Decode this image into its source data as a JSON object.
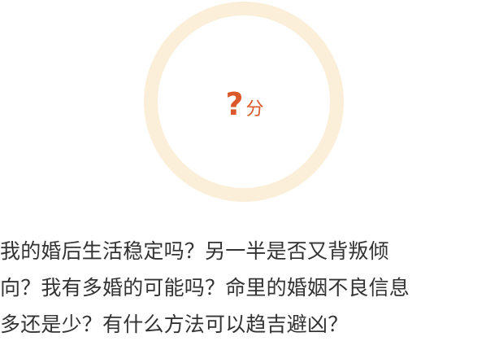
{
  "score": {
    "value": "?",
    "unit": "分"
  },
  "question": {
    "lines": [
      "我的婚后生活稳定吗？另一半是否又背叛倾",
      "向？我有多婚的可能吗？命里的婚姻不良信息",
      "多还是少？有什么方法可以趋吉避凶？"
    ]
  },
  "colors": {
    "ring": "#fbefd9",
    "score": "#d9592a",
    "text": "#333333"
  }
}
